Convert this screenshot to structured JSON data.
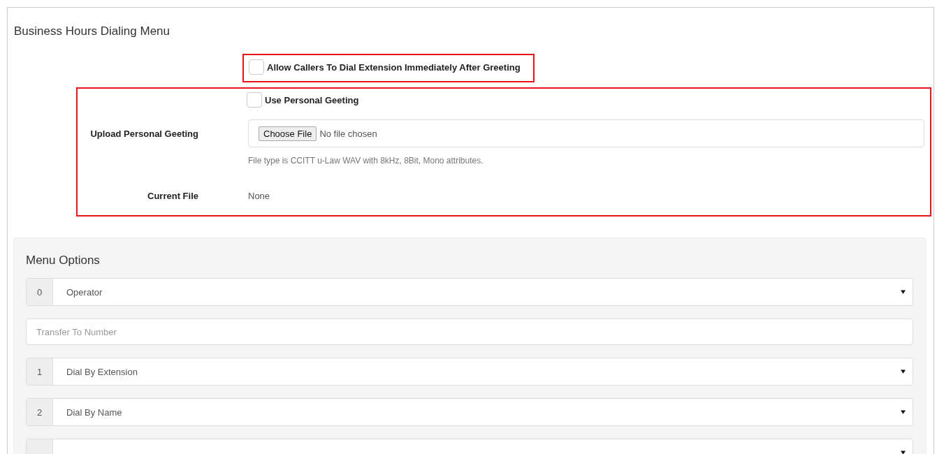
{
  "title": "Business Hours Dialing Menu",
  "allow_dial": {
    "label": "Allow Callers To Dial Extension Immediately After Greeting",
    "checked": false
  },
  "use_personal": {
    "label": "Use Personal Geeting",
    "checked": false
  },
  "upload": {
    "label": "Upload Personal Geeting",
    "button": "Choose File",
    "status": "No file chosen",
    "help": "File type is CCITT u-Law WAV with 8kHz, 8Bit, Mono attributes."
  },
  "current_file": {
    "label": "Current File",
    "value": "None"
  },
  "menu_options": {
    "title": "Menu Options",
    "rows": [
      {
        "kind": "select",
        "index": "0",
        "option": "Operator"
      },
      {
        "kind": "input",
        "placeholder": "Transfer To Number"
      },
      {
        "kind": "select",
        "index": "1",
        "option": "Dial By Extension"
      },
      {
        "kind": "select",
        "index": "2",
        "option": "Dial By Name"
      },
      {
        "kind": "select"
      }
    ]
  }
}
